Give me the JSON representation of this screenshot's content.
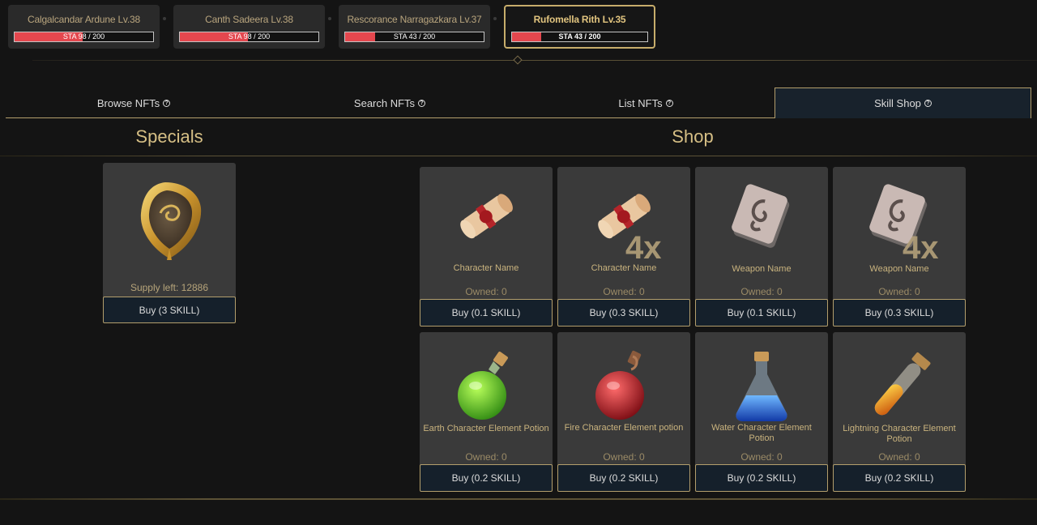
{
  "characters": [
    {
      "name": "Calgalcandar Ardune Lv.38",
      "stamina_label": "STA 98 / 200",
      "stamina": 98,
      "stamina_max": 200,
      "selected": false
    },
    {
      "name": "Canth Sadeera Lv.38",
      "stamina_label": "STA 98 / 200",
      "stamina": 98,
      "stamina_max": 200,
      "selected": false
    },
    {
      "name": "Rescorance Narragazkara Lv.37",
      "stamina_label": "STA 43 / 200",
      "stamina": 43,
      "stamina_max": 200,
      "selected": false
    },
    {
      "name": "Rufomella Rith Lv.35",
      "stamina_label": "STA 43 / 200",
      "stamina": 43,
      "stamina_max": 200,
      "selected": true
    }
  ],
  "tabs": [
    {
      "label": "Browse NFTs",
      "help_icon": "question-circle-icon",
      "active": false
    },
    {
      "label": "Search NFTs",
      "help_icon": "question-circle-icon",
      "active": false
    },
    {
      "label": "List NFTs",
      "help_icon": "question-circle-icon",
      "active": false
    },
    {
      "label": "Skill Shop",
      "help_icon": "question-circle-icon",
      "active": true
    }
  ],
  "specials": {
    "title": "Specials",
    "items": [
      {
        "icon": "golden-shield-icon",
        "supply": "Supply left: 12886",
        "buy_label": "Buy (3 SKILL)"
      }
    ]
  },
  "shop": {
    "title": "Shop",
    "items": [
      {
        "icon": "scroll-icon",
        "name": "Character Name",
        "owned": "Owned: 0",
        "buy_label": "Buy (0.1 SKILL)",
        "multiplier": ""
      },
      {
        "icon": "scroll-icon",
        "name": "Character Name",
        "owned": "Owned: 0",
        "buy_label": "Buy (0.3 SKILL)",
        "multiplier": "4x"
      },
      {
        "icon": "stone-tablet-icon",
        "name": "Weapon Name",
        "owned": "Owned: 0",
        "buy_label": "Buy (0.1 SKILL)",
        "multiplier": ""
      },
      {
        "icon": "stone-tablet-icon",
        "name": "Weapon Name",
        "owned": "Owned: 0",
        "buy_label": "Buy (0.3 SKILL)",
        "multiplier": "4x"
      },
      {
        "icon": "green-potion-icon",
        "name": "Earth Character Element Potion",
        "owned": "Owned: 0",
        "buy_label": "Buy (0.2 SKILL)",
        "multiplier": ""
      },
      {
        "icon": "red-potion-icon",
        "name": "Fire Character Element potion",
        "owned": "Owned: 0",
        "buy_label": "Buy (0.2 SKILL)",
        "multiplier": ""
      },
      {
        "icon": "blue-potion-icon",
        "name": "Water Character Element Potion",
        "owned": "Owned: 0",
        "buy_label": "Buy (0.2 SKILL)",
        "multiplier": ""
      },
      {
        "icon": "yellow-potion-icon",
        "name": "Lightning Character Element Potion",
        "owned": "Owned: 0",
        "buy_label": "Buy (0.2 SKILL)",
        "multiplier": ""
      }
    ]
  },
  "colors": {
    "accent_gold": "#b39e6c",
    "stamina_red": "#e4474e",
    "button_bg": "#15202b"
  }
}
